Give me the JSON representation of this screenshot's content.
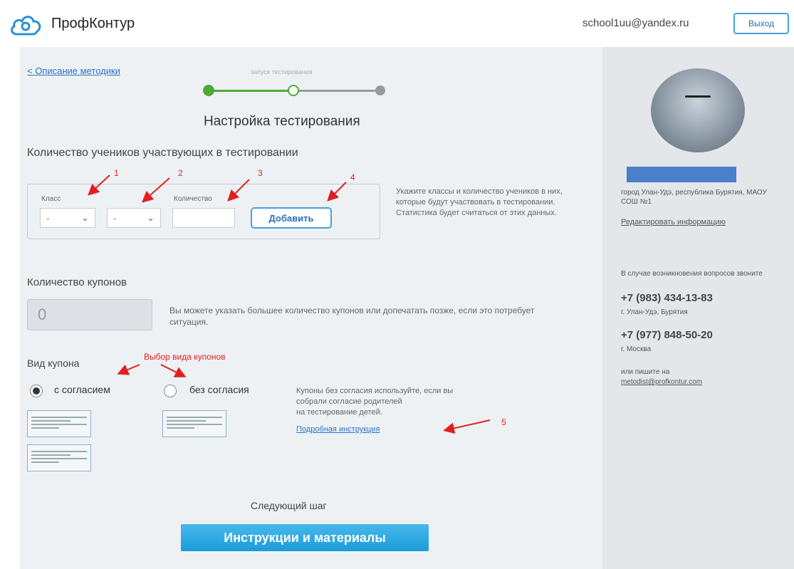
{
  "header": {
    "logo_text": "ПрофКонтур",
    "email": "school1uu@yandex.ru",
    "logout_label": "Выход"
  },
  "nav": {
    "back_link": "Описание методики",
    "stepper_label": "запуск тестирования"
  },
  "page": {
    "title": "Настройка тестирования",
    "students_section_title": "Количество учеников участвующих в тестировании",
    "class_label": "Класс",
    "quantity_label": "Количество",
    "select_class_value": "-",
    "select_letter_value": "-",
    "add_button": "Добавить",
    "students_hint": "Укажите классы и количество учеников в них, которые будут участвовать в тестировании. Статистика будет считаться от этих данных.",
    "coupons_title": "Количество купонов",
    "coupons_value": "0",
    "coupons_hint": "Вы можете указать большее количество купонов или допечатать позже, если это потребует ситуация.",
    "coupon_type_title": "Вид купона",
    "option_with_consent": "с согласием",
    "option_without_consent": "без согласия",
    "consent_hint_lines": [
      "Купоны без согласия используйте, если вы",
      "собрали согласие родителей",
      "на тестирование детей."
    ],
    "instruction_link": "Подробная инструкция",
    "next_step_label": "Следующий шаг",
    "next_button": "Инструкции и материалы"
  },
  "annotations": {
    "n1": "1",
    "n2": "2",
    "n3": "3",
    "n4": "4",
    "n5": "5",
    "coupon_type_note": "Выбор вида купонов"
  },
  "sidebar": {
    "location": "город Улан-Удэ, республика Бурятия, МАОУ СОШ №1",
    "edit_link": "Редактировать информацию",
    "contact_note": "В случае возникновения вопросов звоните",
    "phone1": "+7 (983) 434-13-83",
    "phone1_city": "г. Улан-Удэ, Бурятия",
    "phone2": "+7 (977) 848-50-20",
    "phone2_city": "г. Москва",
    "write_note": "или пишите на",
    "contact_email": "metodist@profkontur.com"
  },
  "colors": {
    "accent": "#4a9ee0",
    "step_done": "#4caa35",
    "annotation_red": "#e02020",
    "primary_button": "#1c9cda"
  }
}
